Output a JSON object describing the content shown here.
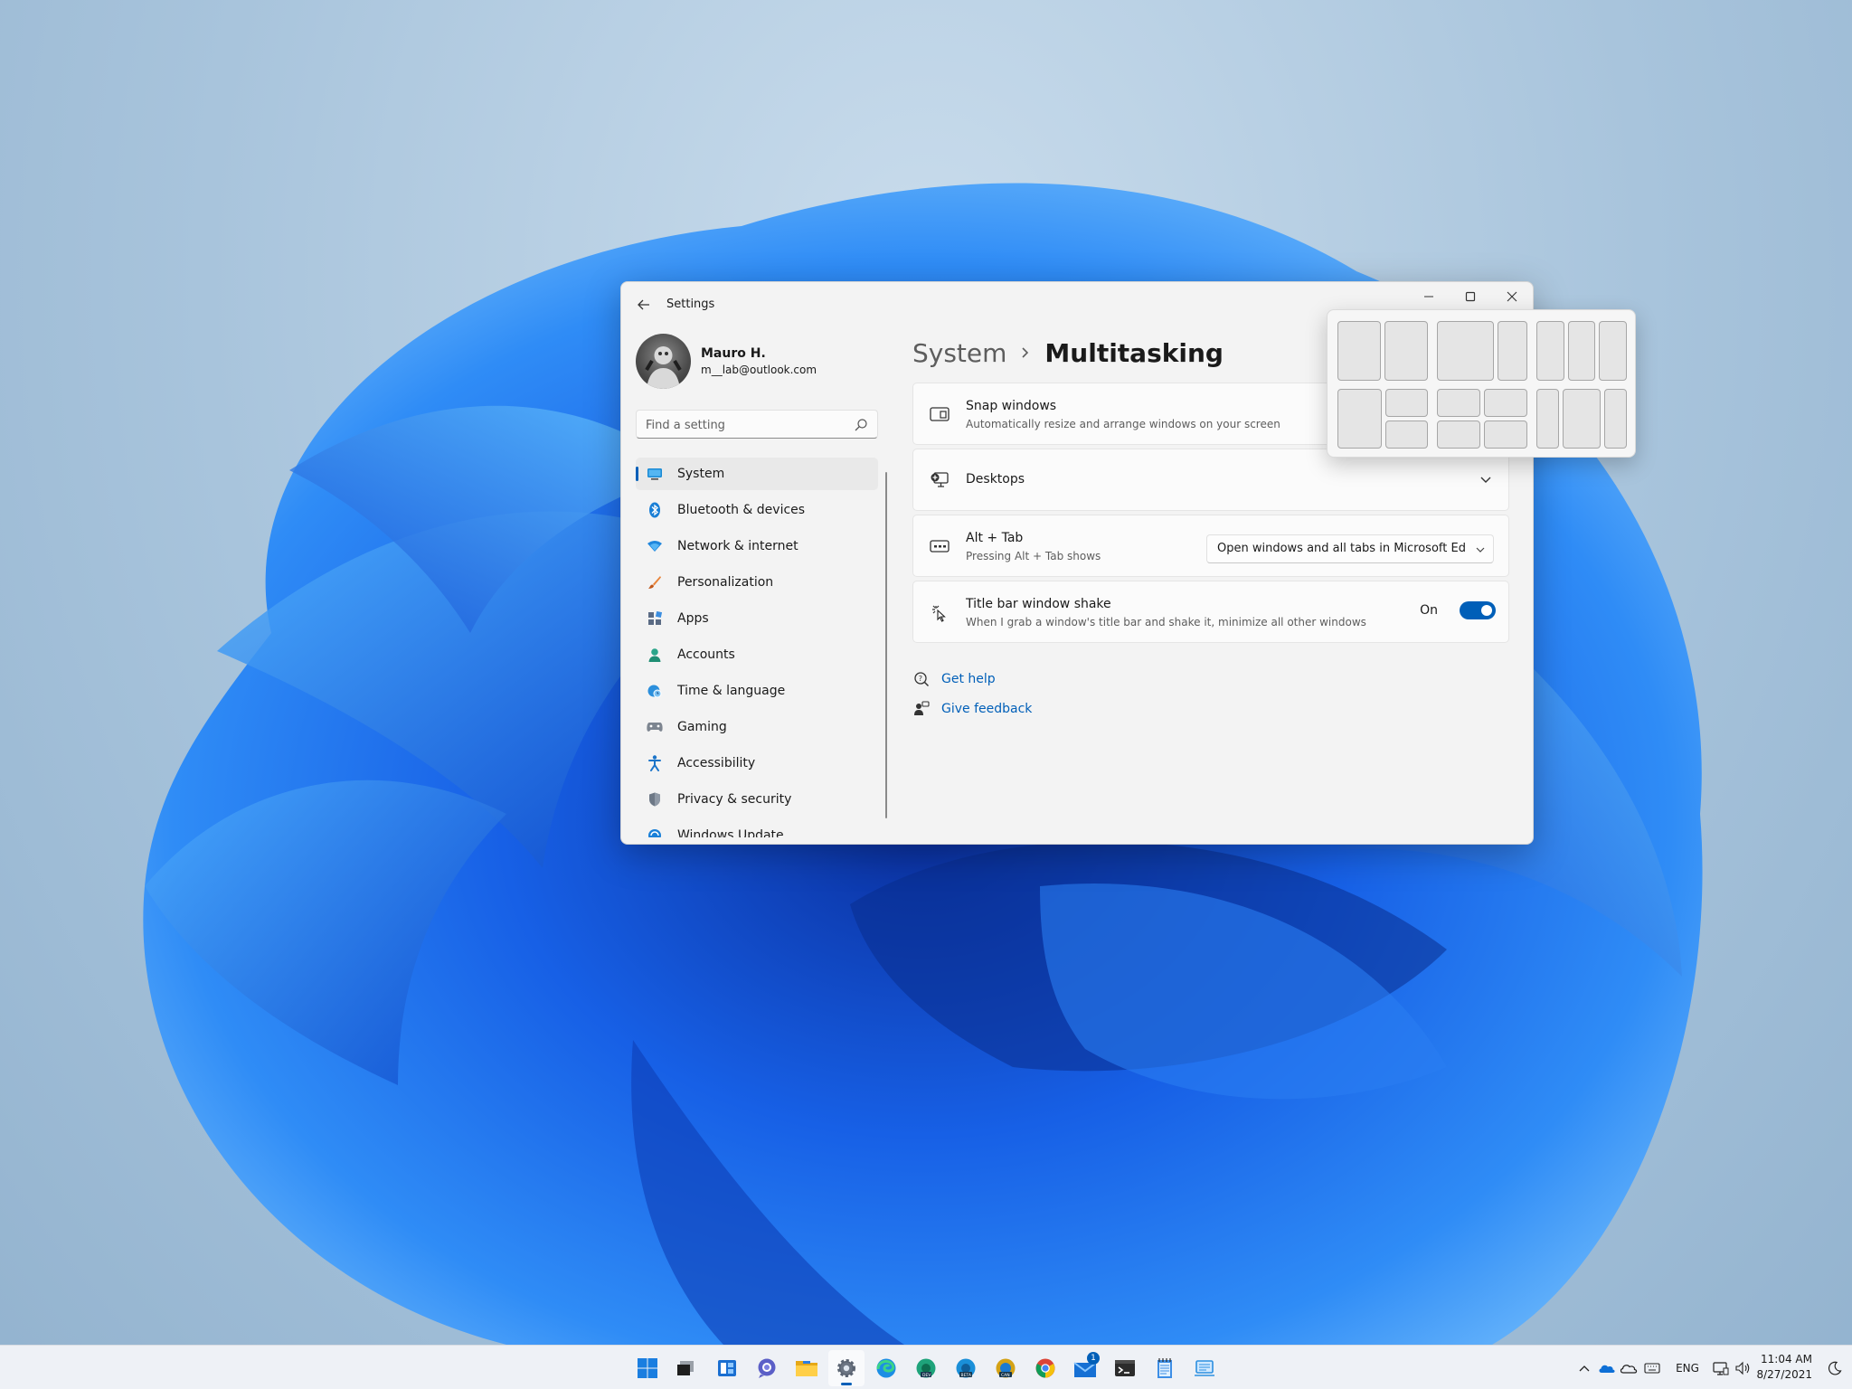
{
  "colors": {
    "accent": "#005fb8",
    "wallpaper_blue": "#1b6ce8",
    "window_bg": "#f3f3f3",
    "card_bg": "#fbfbfb"
  },
  "window": {
    "title": "Settings",
    "back_icon": "back-arrow-icon",
    "caption": {
      "minimize": "minimize-icon",
      "maximize": "maximize-icon",
      "close": "close-icon"
    }
  },
  "profile": {
    "name": "Mauro H.",
    "email": "m__lab@outlook.com"
  },
  "search": {
    "placeholder": "Find a setting",
    "value": "",
    "icon": "search-icon"
  },
  "nav": {
    "selected": "System",
    "items": [
      {
        "label": "System",
        "icon": "system-display-icon"
      },
      {
        "label": "Bluetooth & devices",
        "icon": "bluetooth-icon"
      },
      {
        "label": "Network & internet",
        "icon": "wifi-icon"
      },
      {
        "label": "Personalization",
        "icon": "brush-icon"
      },
      {
        "label": "Apps",
        "icon": "apps-icon"
      },
      {
        "label": "Accounts",
        "icon": "person-icon"
      },
      {
        "label": "Time & language",
        "icon": "globe-clock-icon"
      },
      {
        "label": "Gaming",
        "icon": "gamepad-icon"
      },
      {
        "label": "Accessibility",
        "icon": "accessibility-icon"
      },
      {
        "label": "Privacy & security",
        "icon": "shield-icon"
      },
      {
        "label": "Windows Update",
        "icon": "update-icon"
      }
    ]
  },
  "breadcrumb": {
    "parent": "System",
    "current": "Multitasking"
  },
  "settings": {
    "snap": {
      "title": "Snap windows",
      "description": "Automatically resize and arrange windows on your screen",
      "icon": "snap-windows-icon"
    },
    "desktops": {
      "title": "Desktops",
      "icon": "desktops-icon",
      "expanded": false
    },
    "alt_tab": {
      "title": "Alt + Tab",
      "description": "Pressing Alt + Tab shows",
      "selected_option": "Open windows and all tabs in Microsoft Edge",
      "icon": "alt-tab-icon"
    },
    "shake": {
      "title": "Title bar window shake",
      "description": "When I grab a window's title bar and shake it, minimize all other windows",
      "state_label": "On",
      "enabled": true,
      "icon": "shake-icon"
    }
  },
  "help": {
    "get_help": "Get help",
    "give_feedback": "Give feedback"
  },
  "snap_layouts": {
    "layouts": [
      "two-halves",
      "two-thirds-one-third",
      "three-columns",
      "half-and-two-quarters",
      "four-quadrants",
      "three-columns-wide-center"
    ]
  },
  "taskbar": {
    "apps": [
      {
        "name": "start",
        "icon": "windows-start-icon",
        "active": false
      },
      {
        "name": "search",
        "icon": "task-view-icon",
        "active": false
      },
      {
        "name": "widgets",
        "icon": "widgets-icon",
        "active": false
      },
      {
        "name": "chat",
        "icon": "teams-chat-icon",
        "active": false
      },
      {
        "name": "file-explorer",
        "icon": "folder-icon",
        "active": false
      },
      {
        "name": "settings",
        "icon": "gear-icon",
        "active": true
      },
      {
        "name": "edge",
        "icon": "edge-icon",
        "active": false
      },
      {
        "name": "edge-dev",
        "icon": "edge-dev-icon",
        "active": false
      },
      {
        "name": "edge-beta",
        "icon": "edge-beta-icon",
        "active": false
      },
      {
        "name": "edge-canary",
        "icon": "edge-canary-icon",
        "active": false
      },
      {
        "name": "chrome",
        "icon": "chrome-icon",
        "active": false
      },
      {
        "name": "mail",
        "icon": "mail-icon",
        "active": false,
        "badge": "1"
      },
      {
        "name": "terminal",
        "icon": "terminal-icon",
        "active": false
      },
      {
        "name": "notepad",
        "icon": "notepad-icon",
        "active": false
      },
      {
        "name": "virtual-machine",
        "icon": "hyper-v-icon",
        "active": false
      }
    ],
    "tray": {
      "language": "ENG",
      "time": "11:04 AM",
      "date": "8/27/2021"
    }
  }
}
